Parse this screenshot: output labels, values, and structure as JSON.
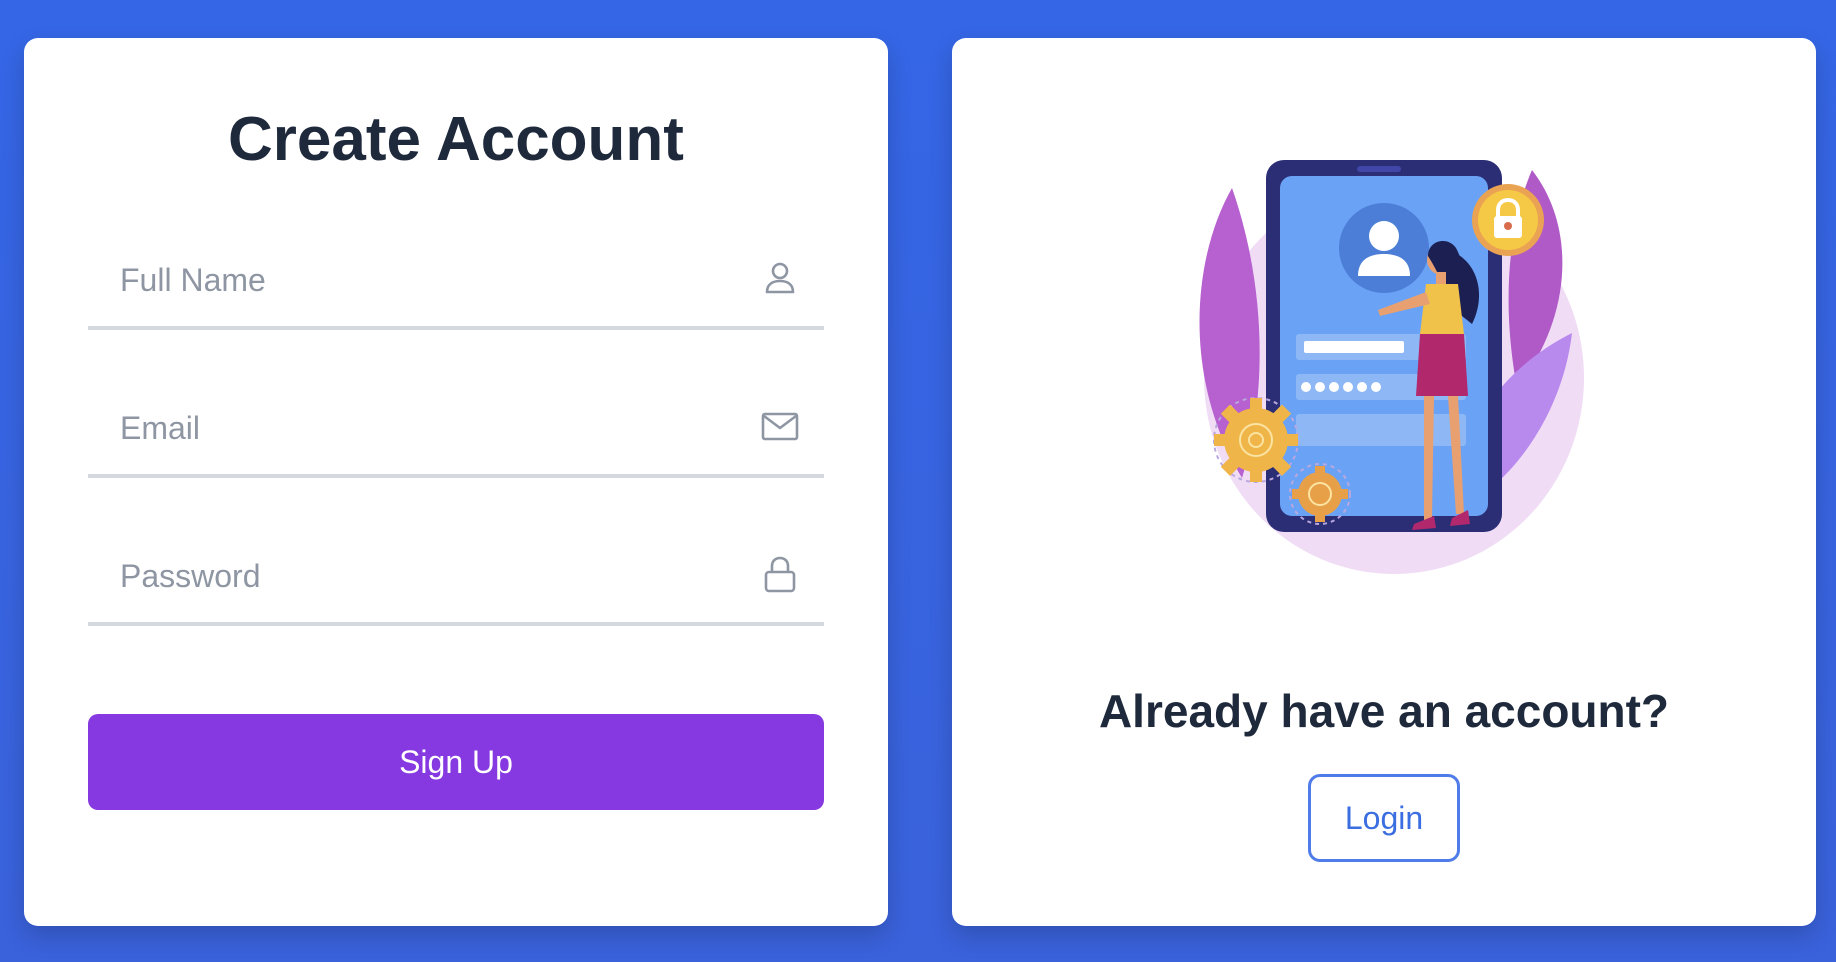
{
  "signup": {
    "title": "Create Account",
    "fields": [
      {
        "placeholder": "Full Name",
        "icon": "user-icon"
      },
      {
        "placeholder": "Email",
        "icon": "mail-icon"
      },
      {
        "placeholder": "Password",
        "icon": "lock-icon"
      }
    ],
    "submit_label": "Sign Up"
  },
  "login": {
    "prompt": "Already have an account?",
    "button_label": "Login",
    "illustration": "phone-login-illustration"
  },
  "colors": {
    "background": "#3566e6",
    "primary_button": "#8639e0",
    "login_outline": "#4f7ce8",
    "heading": "#1e293b"
  }
}
